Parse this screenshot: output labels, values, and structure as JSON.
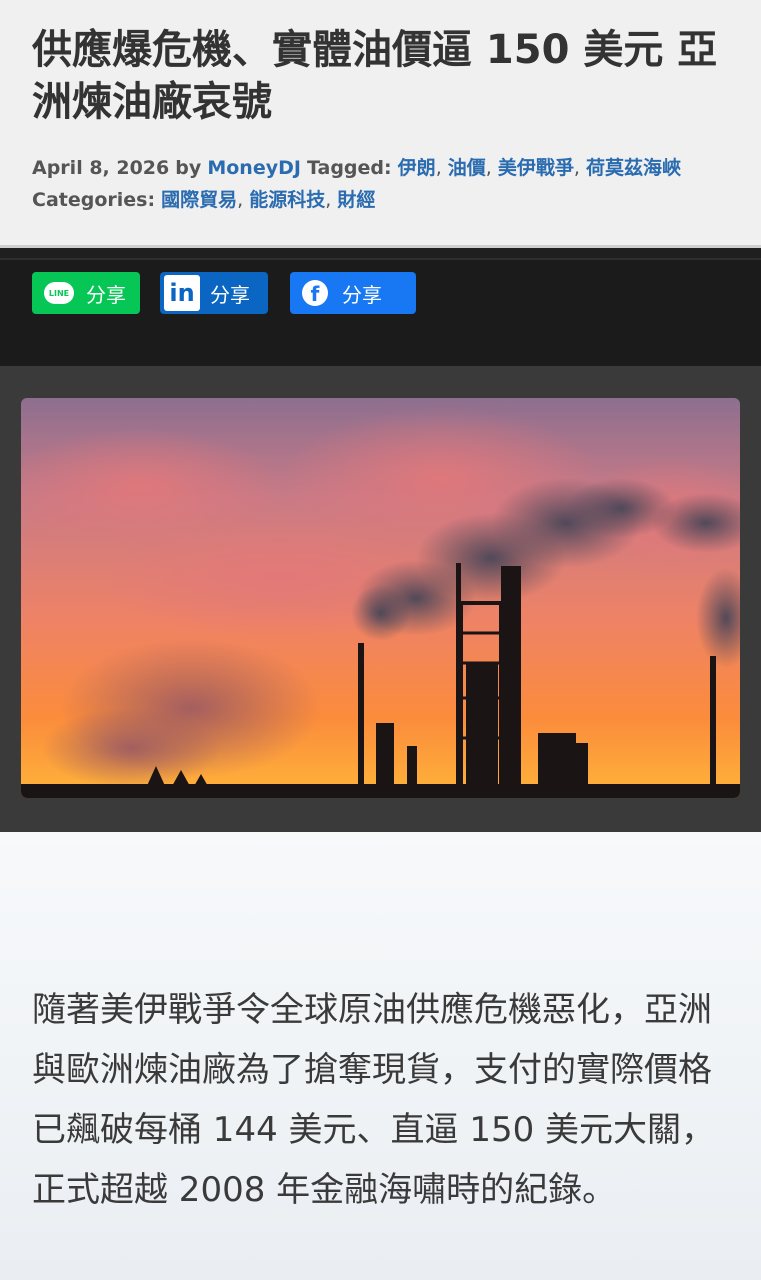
{
  "article": {
    "title": "供應爆危機、實體油價逼 150 美元 亞洲煉油廠哀號",
    "meta": {
      "date": "April 8, 2026",
      "by_label": "by",
      "author": "MoneyDJ",
      "tagged_label": "Tagged:",
      "tags": [
        "伊朗",
        "油價",
        "美伊戰爭",
        "荷莫茲海峽"
      ],
      "categories_label": "Categories:",
      "categories": [
        "國際貿易",
        "能源科技",
        "財經"
      ]
    },
    "body": "隨著美伊戰爭令全球原油供應危機惡化，亞洲與歐洲煉油廠為了搶奪現貨，支付的實際價格已飆破每桶 144 美元、直逼 150 美元大關，正式超越 2008 年金融海嘯時的紀錄。"
  },
  "share": {
    "line": {
      "label": "分享",
      "icon": "line-icon",
      "icon_text": "LINE",
      "color": "#06c755"
    },
    "linkedin": {
      "label": "分享",
      "icon": "linkedin-icon",
      "icon_text": "in",
      "color": "#0a66c2"
    },
    "facebook": {
      "label": "分享",
      "icon": "facebook-icon",
      "icon_text": "f",
      "color": "#1877f2"
    }
  },
  "image": {
    "subject": "oil refinery smokestacks silhouetted against a sunset sky"
  }
}
